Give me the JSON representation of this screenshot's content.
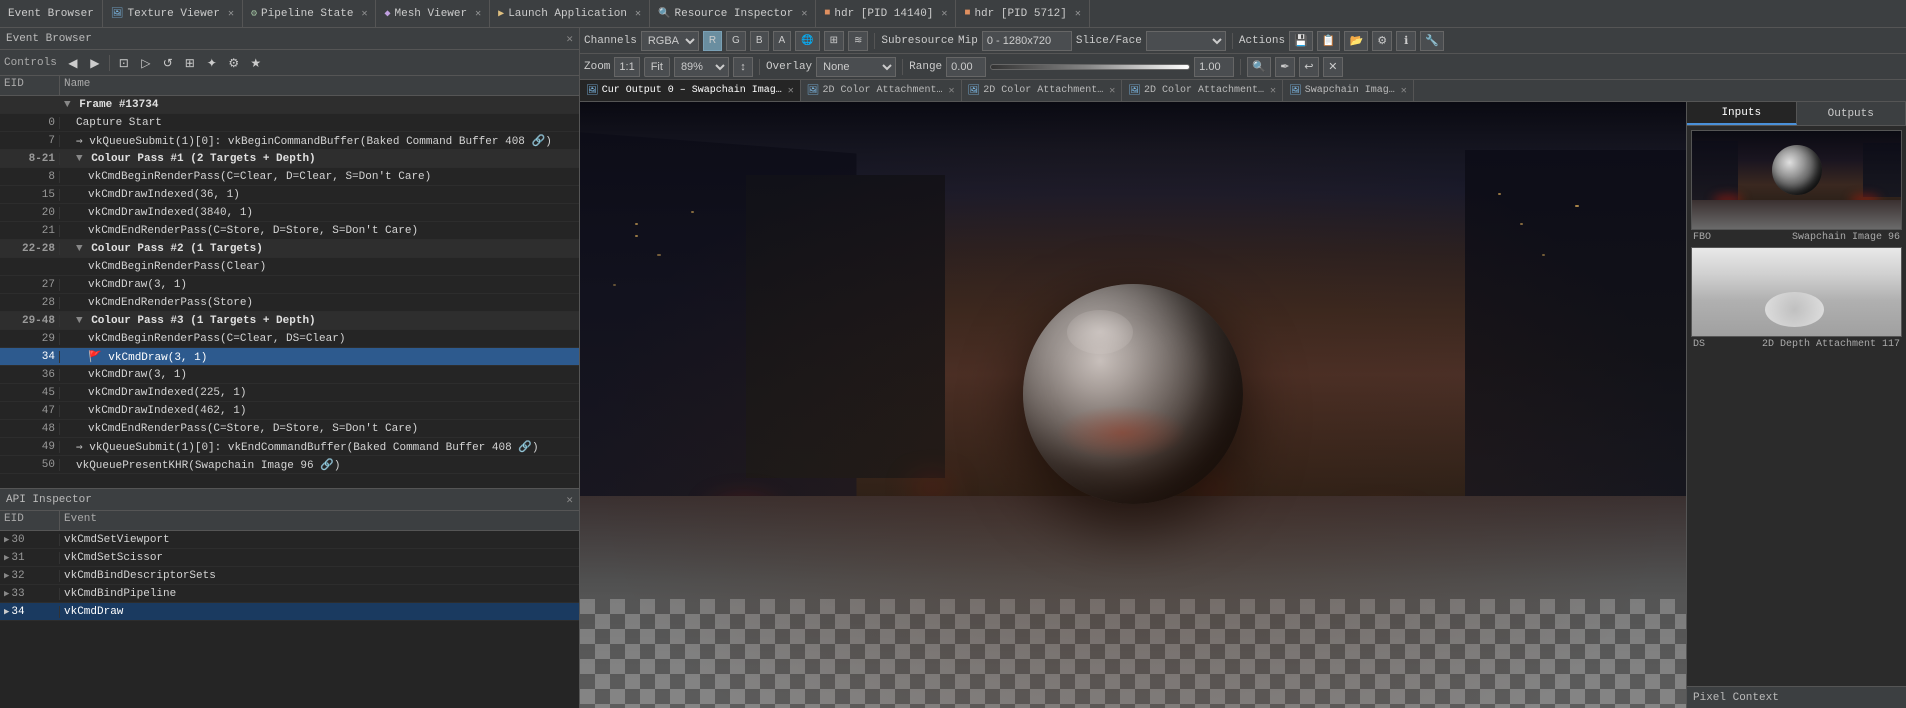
{
  "app": {
    "title": "Event Browser"
  },
  "top_tabs": [
    {
      "id": "texture-viewer",
      "icon": "🖼",
      "label": "Texture Viewer",
      "active": true
    },
    {
      "id": "pipeline-state",
      "icon": "⚙",
      "label": "Pipeline State"
    },
    {
      "id": "mesh-viewer",
      "icon": "🔷",
      "label": "Mesh Viewer"
    },
    {
      "id": "launch-app",
      "icon": "▶",
      "label": "Launch Application"
    },
    {
      "id": "resource-inspector",
      "icon": "🔍",
      "label": "Resource Inspector"
    },
    {
      "id": "hdr-14140",
      "icon": "H",
      "label": "hdr [PID 14140]"
    },
    {
      "id": "hdr-5712",
      "icon": "H",
      "label": "hdr [PID 5712]"
    }
  ],
  "event_browser": {
    "title": "Event Browser",
    "controls_label": "Controls",
    "columns": {
      "eid": "EID",
      "name": "Name"
    },
    "rows": [
      {
        "eid": "",
        "name": "▼ Frame #13734",
        "indent": 0,
        "type": "section"
      },
      {
        "eid": "0",
        "name": "Capture Start",
        "indent": 1
      },
      {
        "eid": "7",
        "name": "=> vkQueueSubmit(1)[0]: vkBeginCommandBuffer(Baked Command Buffer 408 🔗)",
        "indent": 1
      },
      {
        "eid": "8-21",
        "name": "▼ Colour Pass #1 (2 Targets + Depth)",
        "indent": 1,
        "type": "section"
      },
      {
        "eid": "8",
        "name": "vkCmdBeginRenderPass(C=Clear, D=Clear, S=Don't Care)",
        "indent": 2
      },
      {
        "eid": "15",
        "name": "vkCmdDrawIndexed(36, 1)",
        "indent": 2
      },
      {
        "eid": "20",
        "name": "vkCmdDrawIndexed(3840, 1)",
        "indent": 2
      },
      {
        "eid": "21",
        "name": "vkCmdEndRenderPass(C=Store, D=Store, S=Don't Care)",
        "indent": 2
      },
      {
        "eid": "22-28",
        "name": "▼ Colour Pass #2 (1 Targets)",
        "indent": 1,
        "type": "section"
      },
      {
        "eid": "",
        "name": "vkCmdBeginRenderPass(Clear)",
        "indent": 2
      },
      {
        "eid": "27",
        "name": "vkCmdDraw(3, 1)",
        "indent": 2
      },
      {
        "eid": "28",
        "name": "vkCmdEndRenderPass(Store)",
        "indent": 2
      },
      {
        "eid": "29-48",
        "name": "▼ Colour Pass #3 (1 Targets + Depth)",
        "indent": 1,
        "type": "section"
      },
      {
        "eid": "29",
        "name": "vkCmdBeginRenderPass(C=Clear, DS=Clear)",
        "indent": 2
      },
      {
        "eid": "34",
        "name": "🚩 vkCmdDraw(3, 1)",
        "indent": 2,
        "selected": true
      },
      {
        "eid": "36",
        "name": "vkCmdDraw(3, 1)",
        "indent": 2
      },
      {
        "eid": "45",
        "name": "vkCmdDrawIndexed(225, 1)",
        "indent": 2
      },
      {
        "eid": "47",
        "name": "vkCmdDrawIndexed(462, 1)",
        "indent": 2
      },
      {
        "eid": "48",
        "name": "vkCmdEndRenderPass(C=Store, D=Store, S=Don't Care)",
        "indent": 2
      },
      {
        "eid": "49",
        "name": "=> vkQueueSubmit(1)[0]: vkEndCommandBuffer(Baked Command Buffer 408 🔗)",
        "indent": 1
      },
      {
        "eid": "50",
        "name": "vkQueuePresentKHR(Swapchain Image 96 🔗)",
        "indent": 1
      }
    ]
  },
  "api_inspector": {
    "title": "API Inspector",
    "columns": {
      "eid": "EID",
      "event": "Event"
    },
    "rows": [
      {
        "eid": "30",
        "label": "30",
        "event": "vkCmdSetViewport",
        "expanded": false
      },
      {
        "eid": "31",
        "label": "31",
        "event": "vkCmdSetScissor",
        "expanded": false
      },
      {
        "eid": "32",
        "label": "32",
        "event": "vkCmdBindDescriptorSets",
        "expanded": false
      },
      {
        "eid": "33",
        "label": "33",
        "event": "vkCmdBindPipeline",
        "expanded": false
      },
      {
        "eid": "34",
        "label": "34",
        "event": "vkCmdDraw",
        "selected": true
      }
    ]
  },
  "texture_viewer": {
    "toolbar1": {
      "channels_label": "Channels",
      "channels_value": "RGBA",
      "channel_buttons": [
        "R",
        "G",
        "B",
        "A"
      ],
      "subresource_label": "Subresource",
      "mip_label": "Mip",
      "mip_range": "0 - 1280x720",
      "slice_label": "Slice/Face",
      "actions_label": "Actions"
    },
    "toolbar2": {
      "zoom_label": "Zoom",
      "zoom_value": "1:1",
      "fit_label": "Fit",
      "percent_value": "89%",
      "overlay_label": "Overlay",
      "overlay_value": "None",
      "range_label": "Range",
      "range_min": "0.00",
      "range_max": "1.00"
    },
    "output_tabs": [
      {
        "id": "cur-output-0",
        "label": "Cur Output 0 – Swapchain Imag…",
        "active": true,
        "close": true
      },
      {
        "id": "2d-color-att1",
        "label": "2D Color Attachment…",
        "close": true
      },
      {
        "id": "2d-color-att2",
        "label": "2D Color Attachment…",
        "close": true
      },
      {
        "id": "2d-color-att3",
        "label": "2D Color Attachment…",
        "close": true
      },
      {
        "id": "swapchain-imag2",
        "label": "Swapchain Imag…",
        "close": true
      }
    ]
  },
  "side_panel": {
    "tabs": [
      {
        "id": "inputs",
        "label": "Inputs",
        "active": true
      },
      {
        "id": "outputs",
        "label": "Outputs"
      }
    ],
    "thumbnails": [
      {
        "id": "fbo",
        "label_left": "FBO",
        "label_right": "Swapchain Image 96"
      },
      {
        "id": "depth",
        "label_left": "DS",
        "label_right": "2D Depth Attachment 117"
      }
    ],
    "pixel_context_label": "Pixel Context"
  }
}
